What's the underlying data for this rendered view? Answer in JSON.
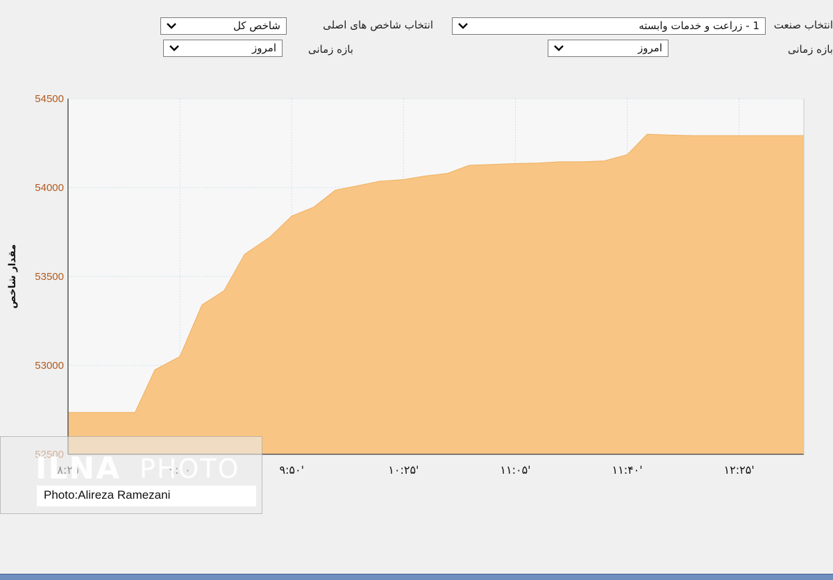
{
  "filters": {
    "industry_label": "انتخاب صنعت",
    "industry_value": "1 - زراعت و خدمات وابسته",
    "index_label": "انتخاب شاخص های اصلی",
    "index_value": "شاخص کل",
    "period_label_right": "بازه زمانی",
    "period_value_right": "امروز",
    "period_label_left": "بازه زمانی",
    "period_value_left": "امروز"
  },
  "watermark": {
    "logo": "ILNA",
    "photo": "PHOTO",
    "credit": "Photo:Alireza Ramezani"
  },
  "chart_data": {
    "type": "area",
    "ylabel": "مقدار شاخص",
    "xlabel": "",
    "ylim": [
      52500,
      54500
    ],
    "yticks": [
      52500,
      53000,
      53500,
      54000,
      54500
    ],
    "xlim": [
      0,
      100
    ],
    "xticks": [
      {
        "x": 0,
        "label": "۸:۲۵"
      },
      {
        "x": 15.2,
        "label": "۹:۰۰"
      },
      {
        "x": 30.4,
        "label": "۹:۵۰'"
      },
      {
        "x": 45.6,
        "label": "۱۰:۲۵'"
      },
      {
        "x": 60.8,
        "label": "۱۱:۰۵'"
      },
      {
        "x": 76.0,
        "label": "۱۱:۴۰'"
      },
      {
        "x": 91.2,
        "label": "۱۲:۲۵'"
      }
    ],
    "color": "#f8c584",
    "grid": true,
    "points": [
      [
        0.0,
        52735
      ],
      [
        9.1,
        52735
      ],
      [
        11.8,
        52975
      ],
      [
        15.2,
        53050
      ],
      [
        18.2,
        53340
      ],
      [
        21.2,
        53420
      ],
      [
        24.0,
        53625
      ],
      [
        27.4,
        53720
      ],
      [
        30.4,
        53840
      ],
      [
        33.4,
        53890
      ],
      [
        36.3,
        53985
      ],
      [
        39.4,
        54010
      ],
      [
        42.3,
        54035
      ],
      [
        45.6,
        54045
      ],
      [
        48.5,
        54065
      ],
      [
        51.6,
        54080
      ],
      [
        54.5,
        54125
      ],
      [
        57.7,
        54130
      ],
      [
        60.8,
        54135
      ],
      [
        63.8,
        54138
      ],
      [
        66.8,
        54145
      ],
      [
        69.8,
        54145
      ],
      [
        72.9,
        54150
      ],
      [
        76.0,
        54185
      ],
      [
        78.7,
        54300
      ],
      [
        82.1,
        54295
      ],
      [
        85.2,
        54292
      ],
      [
        88.2,
        54292
      ],
      [
        91.2,
        54292
      ],
      [
        94.2,
        54292
      ],
      [
        97.2,
        54292
      ],
      [
        100.0,
        54292
      ]
    ]
  }
}
